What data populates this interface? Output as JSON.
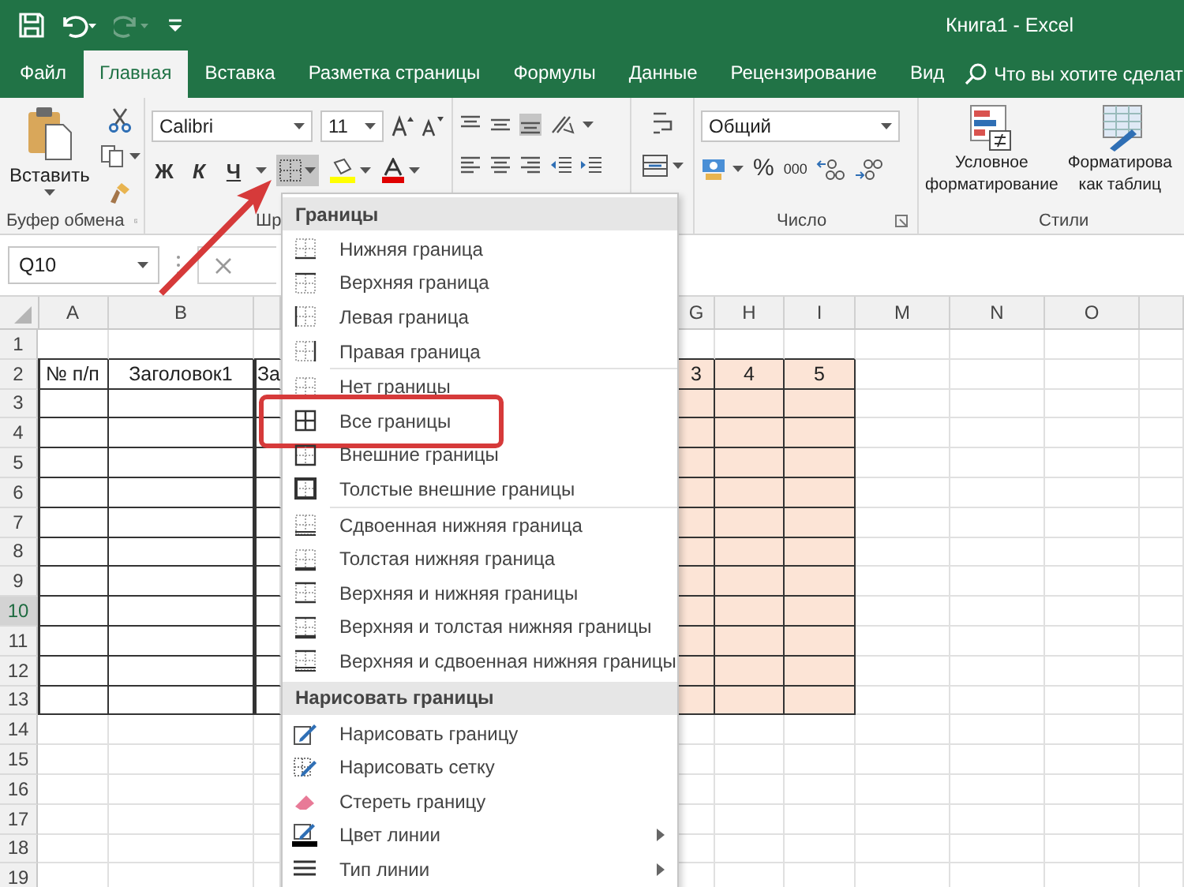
{
  "window": {
    "title": "Книга1 - Excel"
  },
  "quick_access": [
    {
      "kind": "save",
      "disabled": false
    },
    {
      "kind": "undo",
      "disabled": false
    },
    {
      "kind": "redo",
      "disabled": true
    },
    {
      "kind": "customize",
      "disabled": false
    }
  ],
  "tabs": [
    {
      "label": "Файл",
      "selected": false
    },
    {
      "label": "Главная",
      "selected": true
    },
    {
      "label": "Вставка",
      "selected": false
    },
    {
      "label": "Разметка страницы",
      "selected": false
    },
    {
      "label": "Формулы",
      "selected": false
    },
    {
      "label": "Данные",
      "selected": false
    },
    {
      "label": "Рецензирование",
      "selected": false
    },
    {
      "label": "Вид",
      "selected": false
    }
  ],
  "tell_me": {
    "label": "Что вы хотите сделат"
  },
  "ribbon": {
    "clipboard": {
      "paste_label": "Вставить",
      "group_label": "Буфер обмена"
    },
    "font": {
      "font_name": "Calibri",
      "font_size": "11",
      "bold": "Ж",
      "italic": "К",
      "underline": "Ч",
      "borders_pressed": true,
      "group_label": "Шр"
    },
    "number": {
      "format": "Общий",
      "percent": "%",
      "thousands": "000",
      "group_label": "Число"
    },
    "styles": {
      "conditional_lines": [
        "Условное",
        "форматирование"
      ],
      "table_lines": [
        "Форматирова",
        "как таблиц"
      ],
      "group_label": "Стили"
    }
  },
  "formula_bar": {
    "name_box": "Q10"
  },
  "sheet": {
    "columns": [
      "A",
      "B",
      "G",
      "H",
      "I",
      "M",
      "N",
      "O"
    ],
    "rows": [
      {
        "number": "1",
        "selected": false,
        "bordered": false
      },
      {
        "number": "2",
        "selected": false,
        "bordered": true,
        "cells": {
          "a": "№ п/п",
          "b": "Заголовок1",
          "c": "За",
          "g": "3",
          "h": "4",
          "i": "5"
        }
      },
      {
        "number": "3",
        "selected": false,
        "bordered": true
      },
      {
        "number": "4",
        "selected": false,
        "bordered": true
      },
      {
        "number": "5",
        "selected": false,
        "bordered": true
      },
      {
        "number": "6",
        "selected": false,
        "bordered": true
      },
      {
        "number": "7",
        "selected": false,
        "bordered": true
      },
      {
        "number": "8",
        "selected": false,
        "bordered": true
      },
      {
        "number": "9",
        "selected": false,
        "bordered": true
      },
      {
        "number": "10",
        "selected": true,
        "bordered": true
      },
      {
        "number": "11",
        "selected": false,
        "bordered": true
      },
      {
        "number": "12",
        "selected": false,
        "bordered": true
      },
      {
        "number": "13",
        "selected": false,
        "bordered": true
      },
      {
        "number": "14",
        "selected": false,
        "bordered": false
      },
      {
        "number": "15",
        "selected": false,
        "bordered": false
      },
      {
        "number": "16",
        "selected": false,
        "bordered": false
      },
      {
        "number": "17",
        "selected": false,
        "bordered": false
      },
      {
        "number": "18",
        "selected": false,
        "bordered": false
      },
      {
        "number": "19",
        "selected": false,
        "bordered": false
      }
    ]
  },
  "borders_menu": {
    "sections": [
      {
        "title": "Границы",
        "groups": [
          [
            {
              "label": "Нижняя граница",
              "kind": "bottom",
              "highlighted": false
            },
            {
              "label": "Верхняя граница",
              "kind": "top",
              "highlighted": false
            },
            {
              "label": "Левая граница",
              "kind": "left",
              "highlighted": false
            },
            {
              "label": "Правая граница",
              "kind": "right",
              "highlighted": false
            }
          ],
          [
            {
              "label": "Нет границы",
              "kind": "none",
              "highlighted": false
            },
            {
              "label": "Все границы",
              "kind": "all",
              "highlighted": true
            },
            {
              "label": "Внешние границы",
              "kind": "outside",
              "highlighted": false
            },
            {
              "label": "Толстые внешние границы",
              "kind": "thick_outside",
              "highlighted": false
            }
          ],
          [
            {
              "label": "Сдвоенная нижняя граница",
              "kind": "double_bottom",
              "highlighted": false
            },
            {
              "label": "Толстая нижняя граница",
              "kind": "thick_bottom",
              "highlighted": false
            },
            {
              "label": "Верхняя и нижняя границы",
              "kind": "top_bottom",
              "highlighted": false
            },
            {
              "label": "Верхняя и толстая нижняя границы",
              "kind": "top_thick_bottom",
              "highlighted": false
            },
            {
              "label": "Верхняя и сдвоенная нижняя границы",
              "kind": "top_double_bottom",
              "highlighted": false
            }
          ]
        ]
      },
      {
        "title": "Нарисовать границы",
        "groups": [
          [
            {
              "label": "Нарисовать границу",
              "kind": "draw_border",
              "highlighted": false
            },
            {
              "label": "Нарисовать сетку",
              "kind": "draw_grid",
              "highlighted": false
            },
            {
              "label": "Стереть границу",
              "kind": "erase",
              "highlighted": false
            },
            {
              "label": "Цвет линии",
              "kind": "line_color",
              "highlighted": false,
              "submenu": true
            },
            {
              "label": "Тип линии",
              "kind": "line_style",
              "highlighted": false,
              "submenu": true
            }
          ]
        ]
      }
    ]
  }
}
